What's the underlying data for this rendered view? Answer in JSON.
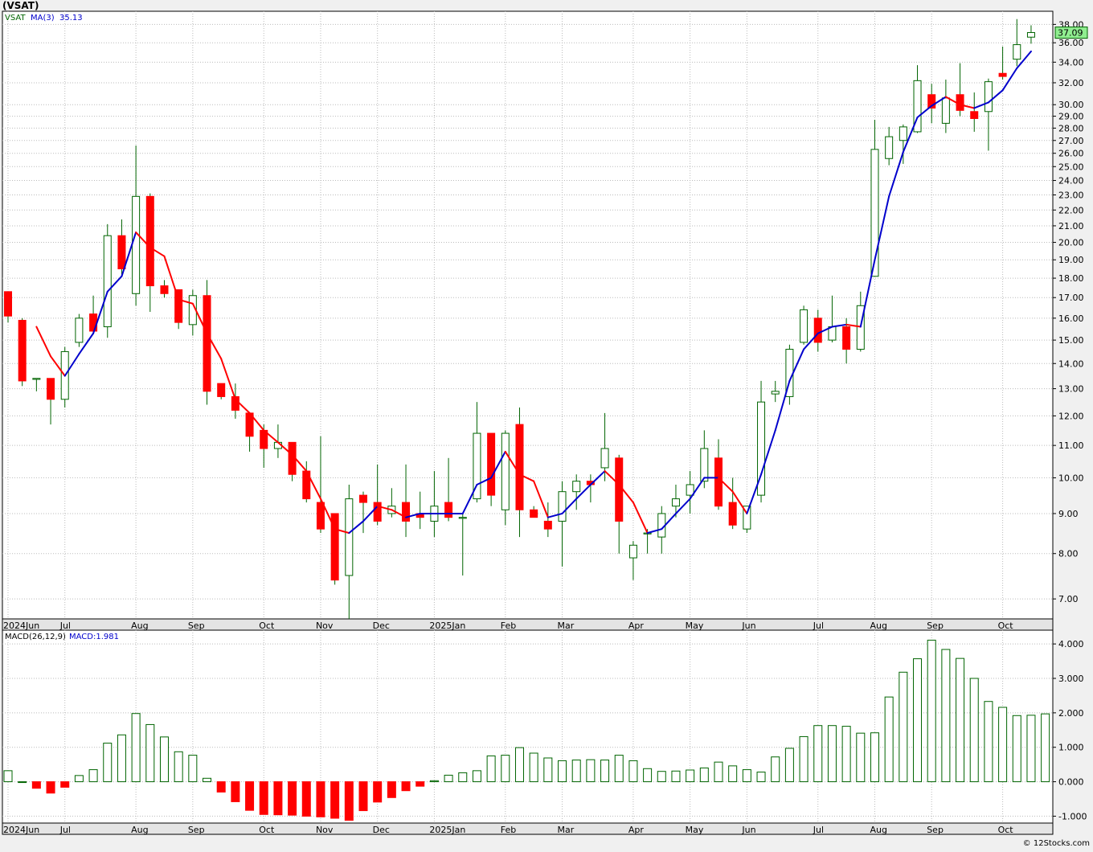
{
  "header": {
    "ticker_title": "(VSAT)"
  },
  "legend": {
    "symbol": "VSAT",
    "ma_label": "MA(3)",
    "ma_value": "35.13",
    "last_price": "37.09",
    "macd_params": "MACD(26,12,9)",
    "macd_value": "MACD:1.981"
  },
  "footer": {
    "credit": "© 12Stocks.com"
  },
  "x_labels": [
    {
      "label": "2024Jun",
      "i": 0
    },
    {
      "label": "Jul",
      "i": 4
    },
    {
      "label": "Aug",
      "i": 9
    },
    {
      "label": "Sep",
      "i": 13
    },
    {
      "label": "Oct",
      "i": 18
    },
    {
      "label": "Nov",
      "i": 22
    },
    {
      "label": "Dec",
      "i": 26
    },
    {
      "label": "2025Jan",
      "i": 30
    },
    {
      "label": "Feb",
      "i": 35
    },
    {
      "label": "Mar",
      "i": 39
    },
    {
      "label": "Apr",
      "i": 44
    },
    {
      "label": "May",
      "i": 48
    },
    {
      "label": "Jun",
      "i": 52
    },
    {
      "label": "Jul",
      "i": 57
    },
    {
      "label": "Aug",
      "i": 61
    },
    {
      "label": "Sep",
      "i": 65
    },
    {
      "label": "Oct",
      "i": 70
    }
  ],
  "colors": {
    "up_candle": "#ffffff",
    "down_candle": "#ff0000",
    "candle_outline": "#006400",
    "ma_rising": "#0000cc",
    "ma_falling": "#ff0000",
    "macd_positive": "#006400",
    "macd_negative": "#ff0000",
    "last_price_box": "#90ee90"
  },
  "chart_data": [
    {
      "type": "candlestick",
      "title": "(VSAT)",
      "scale": "log",
      "ylim": [
        6.6,
        39.5
      ],
      "yticks": [
        "38.00",
        "36.00",
        "34.00",
        "32.00",
        "30.00",
        "29.00",
        "28.00",
        "27.00",
        "26.00",
        "25.00",
        "24.00",
        "23.00",
        "22.00",
        "21.00",
        "20.00",
        "19.00",
        "18.00",
        "17.00",
        "16.00",
        "15.00",
        "14.00",
        "13.00",
        "12.00",
        "11.00",
        "10.00",
        "9.00",
        "8.00",
        "7.00"
      ],
      "grid": true,
      "candles": [
        {
          "o": 17.3,
          "h": 17.3,
          "l": 15.8,
          "c": 16.1
        },
        {
          "o": 15.9,
          "h": 16.0,
          "l": 13.1,
          "c": 13.3
        },
        {
          "o": 13.4,
          "h": 13.4,
          "l": 12.9,
          "c": 13.4
        },
        {
          "o": 13.4,
          "h": 13.4,
          "l": 11.7,
          "c": 12.6
        },
        {
          "o": 12.6,
          "h": 14.7,
          "l": 12.3,
          "c": 14.5
        },
        {
          "o": 14.9,
          "h": 16.2,
          "l": 14.7,
          "c": 16.0
        },
        {
          "o": 16.2,
          "h": 17.1,
          "l": 15.3,
          "c": 15.4
        },
        {
          "o": 15.6,
          "h": 21.1,
          "l": 15.1,
          "c": 20.4
        },
        {
          "o": 20.4,
          "h": 21.4,
          "l": 18.2,
          "c": 18.5
        },
        {
          "o": 17.2,
          "h": 26.6,
          "l": 16.6,
          "c": 22.9
        },
        {
          "o": 22.9,
          "h": 23.1,
          "l": 16.3,
          "c": 17.6
        },
        {
          "o": 17.6,
          "h": 17.9,
          "l": 17.0,
          "c": 17.2
        },
        {
          "o": 17.4,
          "h": 17.4,
          "l": 15.5,
          "c": 15.8
        },
        {
          "o": 15.7,
          "h": 17.4,
          "l": 15.2,
          "c": 17.1
        },
        {
          "o": 17.1,
          "h": 17.9,
          "l": 12.4,
          "c": 12.9
        },
        {
          "o": 13.2,
          "h": 13.2,
          "l": 12.6,
          "c": 12.7
        },
        {
          "o": 12.7,
          "h": 13.2,
          "l": 11.9,
          "c": 12.2
        },
        {
          "o": 12.1,
          "h": 12.1,
          "l": 10.8,
          "c": 11.3
        },
        {
          "o": 11.5,
          "h": 11.7,
          "l": 10.3,
          "c": 10.9
        },
        {
          "o": 10.9,
          "h": 11.7,
          "l": 10.6,
          "c": 11.1
        },
        {
          "o": 11.1,
          "h": 11.1,
          "l": 9.9,
          "c": 10.1
        },
        {
          "o": 10.2,
          "h": 10.5,
          "l": 9.3,
          "c": 9.4
        },
        {
          "o": 9.3,
          "h": 11.3,
          "l": 8.5,
          "c": 8.6
        },
        {
          "o": 9.0,
          "h": 9.0,
          "l": 7.3,
          "c": 7.4
        },
        {
          "o": 7.5,
          "h": 9.8,
          "l": 6.6,
          "c": 9.4
        },
        {
          "o": 9.5,
          "h": 9.6,
          "l": 8.5,
          "c": 9.3
        },
        {
          "o": 9.3,
          "h": 10.4,
          "l": 8.7,
          "c": 8.8
        },
        {
          "o": 9.0,
          "h": 9.7,
          "l": 8.9,
          "c": 9.2
        },
        {
          "o": 9.3,
          "h": 10.4,
          "l": 8.4,
          "c": 8.8
        },
        {
          "o": 9.0,
          "h": 9.6,
          "l": 8.6,
          "c": 8.9
        },
        {
          "o": 8.8,
          "h": 10.2,
          "l": 8.4,
          "c": 9.2
        },
        {
          "o": 9.3,
          "h": 10.6,
          "l": 8.8,
          "c": 8.9
        },
        {
          "o": 8.9,
          "h": 9.0,
          "l": 7.5,
          "c": 8.9
        },
        {
          "o": 9.4,
          "h": 12.5,
          "l": 9.3,
          "c": 11.4
        },
        {
          "o": 11.4,
          "h": 11.4,
          "l": 9.2,
          "c": 9.5
        },
        {
          "o": 9.1,
          "h": 11.5,
          "l": 8.7,
          "c": 11.4
        },
        {
          "o": 11.7,
          "h": 12.3,
          "l": 8.4,
          "c": 9.1
        },
        {
          "o": 9.1,
          "h": 9.2,
          "l": 8.9,
          "c": 8.9
        },
        {
          "o": 8.8,
          "h": 9.3,
          "l": 8.4,
          "c": 8.6
        },
        {
          "o": 8.8,
          "h": 9.9,
          "l": 7.7,
          "c": 9.6
        },
        {
          "o": 9.6,
          "h": 10.1,
          "l": 9.1,
          "c": 9.9
        },
        {
          "o": 9.9,
          "h": 10.1,
          "l": 9.3,
          "c": 9.8
        },
        {
          "o": 10.3,
          "h": 12.1,
          "l": 9.9,
          "c": 10.9
        },
        {
          "o": 10.6,
          "h": 10.7,
          "l": 8.0,
          "c": 8.8
        },
        {
          "o": 7.9,
          "h": 8.3,
          "l": 7.4,
          "c": 8.2
        },
        {
          "o": 8.5,
          "h": 8.6,
          "l": 8.0,
          "c": 8.5
        },
        {
          "o": 8.4,
          "h": 9.2,
          "l": 8.0,
          "c": 9.0
        },
        {
          "o": 9.2,
          "h": 9.8,
          "l": 8.9,
          "c": 9.4
        },
        {
          "o": 9.5,
          "h": 10.2,
          "l": 9.0,
          "c": 9.8
        },
        {
          "o": 9.9,
          "h": 11.5,
          "l": 9.7,
          "c": 10.9
        },
        {
          "o": 10.6,
          "h": 11.2,
          "l": 9.1,
          "c": 9.2
        },
        {
          "o": 9.3,
          "h": 10.0,
          "l": 8.6,
          "c": 8.7
        },
        {
          "o": 8.6,
          "h": 9.2,
          "l": 8.5,
          "c": 9.2
        },
        {
          "o": 9.5,
          "h": 13.3,
          "l": 9.3,
          "c": 12.5
        },
        {
          "o": 12.8,
          "h": 13.3,
          "l": 12.5,
          "c": 12.9
        },
        {
          "o": 12.7,
          "h": 14.8,
          "l": 12.4,
          "c": 14.6
        },
        {
          "o": 14.9,
          "h": 16.6,
          "l": 14.8,
          "c": 16.4
        },
        {
          "o": 16.0,
          "h": 16.4,
          "l": 14.5,
          "c": 14.9
        },
        {
          "o": 15.0,
          "h": 17.1,
          "l": 14.9,
          "c": 15.6
        },
        {
          "o": 15.6,
          "h": 16.0,
          "l": 14.0,
          "c": 14.6
        },
        {
          "o": 14.6,
          "h": 17.3,
          "l": 14.5,
          "c": 16.6
        },
        {
          "o": 18.1,
          "h": 28.7,
          "l": 18.1,
          "c": 26.3
        },
        {
          "o": 25.6,
          "h": 28.1,
          "l": 25.1,
          "c": 27.3
        },
        {
          "o": 27.0,
          "h": 28.3,
          "l": 25.2,
          "c": 28.1
        },
        {
          "o": 27.7,
          "h": 33.7,
          "l": 27.6,
          "c": 32.2
        },
        {
          "o": 30.9,
          "h": 31.9,
          "l": 28.4,
          "c": 29.7
        },
        {
          "o": 28.4,
          "h": 32.3,
          "l": 27.6,
          "c": 30.6
        },
        {
          "o": 30.9,
          "h": 33.9,
          "l": 29.0,
          "c": 29.5
        },
        {
          "o": 29.4,
          "h": 31.1,
          "l": 27.7,
          "c": 28.8
        },
        {
          "o": 29.4,
          "h": 32.4,
          "l": 26.2,
          "c": 32.1
        },
        {
          "o": 32.9,
          "h": 35.6,
          "l": 32.3,
          "c": 32.6
        },
        {
          "o": 34.3,
          "h": 38.6,
          "l": 33.6,
          "c": 35.8
        },
        {
          "o": 36.6,
          "h": 37.9,
          "l": 35.9,
          "c": 37.1
        }
      ],
      "ma3": [
        null,
        null,
        15.6,
        14.3,
        13.5,
        14.4,
        15.3,
        17.3,
        18.1,
        20.6,
        19.7,
        19.2,
        16.9,
        16.7,
        15.3,
        14.2,
        12.6,
        12.1,
        11.5,
        11.1,
        10.7,
        10.2,
        9.4,
        8.6,
        8.5,
        8.8,
        9.2,
        9.1,
        8.9,
        9.0,
        9.0,
        9.0,
        9.0,
        9.8,
        10.0,
        10.8,
        10.1,
        9.9,
        8.9,
        9.0,
        9.4,
        9.8,
        10.2,
        9.8,
        9.3,
        8.5,
        8.6,
        9.0,
        9.4,
        10.0,
        10.0,
        9.6,
        9.0,
        10.1,
        11.5,
        13.3,
        14.6,
        15.3,
        15.6,
        15.7,
        15.6,
        19.0,
        22.9,
        26.1,
        28.9,
        29.9,
        30.7,
        30.0,
        29.7,
        30.2,
        31.3,
        33.4,
        35.1
      ],
      "xlabel": "",
      "ylabel": ""
    },
    {
      "type": "bar",
      "title": "MACD(26,12,9)",
      "ylim": [
        -1.2,
        4.4
      ],
      "yticks": [
        "4.000",
        "3.000",
        "2.000",
        "1.000",
        "0.000",
        "-1.000"
      ],
      "grid": true,
      "values": [
        0.32,
        0.0,
        -0.19,
        -0.33,
        -0.16,
        0.18,
        0.35,
        1.12,
        1.36,
        1.98,
        1.66,
        1.3,
        0.87,
        0.77,
        0.1,
        -0.3,
        -0.58,
        -0.83,
        -0.95,
        -0.96,
        -0.97,
        -1.0,
        -1.02,
        -1.06,
        -1.12,
        -0.84,
        -0.59,
        -0.46,
        -0.26,
        -0.13,
        0.03,
        0.19,
        0.26,
        0.32,
        0.75,
        0.77,
        0.99,
        0.83,
        0.69,
        0.61,
        0.63,
        0.64,
        0.63,
        0.77,
        0.61,
        0.38,
        0.3,
        0.31,
        0.34,
        0.4,
        0.57,
        0.46,
        0.35,
        0.28,
        0.72,
        0.97,
        1.31,
        1.63,
        1.63,
        1.61,
        1.41,
        1.42,
        2.46,
        3.18,
        3.57,
        4.11,
        3.84,
        3.58,
        3.0,
        2.33,
        2.16,
        1.92,
        1.93,
        1.97
      ],
      "xlabel": "",
      "ylabel": ""
    }
  ]
}
